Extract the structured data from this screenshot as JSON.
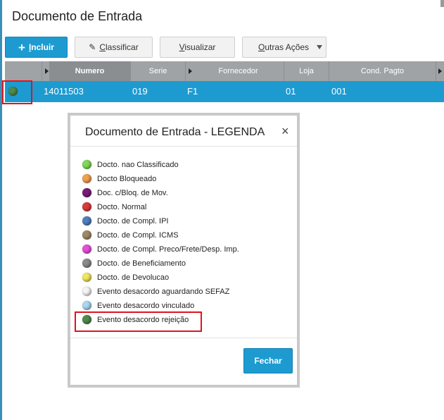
{
  "page": {
    "title": "Documento de Entrada"
  },
  "toolbar": {
    "incluir_plus": "+",
    "incluir_underlined": "I",
    "incluir_rest": "ncluir",
    "classificar_underlined": "C",
    "classificar_rest": "lassificar",
    "visualizar_underlined": "V",
    "visualizar_rest": "isualizar",
    "outras_underlined": "O",
    "outras_rest": "utras Ações"
  },
  "grid": {
    "columns": {
      "numero": "Numero",
      "serie": "Serie",
      "fornecedor": "Fornecedor",
      "loja": "Loja",
      "cond_pagto": "Cond. Pagto"
    },
    "row": {
      "status_color": "#4f8a4a",
      "numero": "14011503",
      "serie": "019",
      "fornecedor": "F1",
      "loja": "01",
      "cond_pagto": "001"
    }
  },
  "modal": {
    "title": "Documento de Entrada - LEGENDA",
    "close_icon": "×",
    "items": [
      {
        "label": "Docto. nao Classificado",
        "color": "#7ed957"
      },
      {
        "label": "Docto Bloqueado",
        "color": "#f0a050"
      },
      {
        "label": "Doc. c/Bloq. de Mov.",
        "color": "#7a1a7a"
      },
      {
        "label": "Docto. Normal",
        "color": "#d93a3a"
      },
      {
        "label": "Docto. de Compl. IPI",
        "color": "#4f7fc0"
      },
      {
        "label": "Docto. de Compl. ICMS",
        "color": "#a08866"
      },
      {
        "label": "Docto. de Compl. Preco/Frete/Desp. Imp.",
        "color": "#e64fd8"
      },
      {
        "label": "Docto. de Beneficiamento",
        "color": "#8a8a8a"
      },
      {
        "label": "Docto. de Devolucao",
        "color": "#f0e65a"
      },
      {
        "label": "Evento desacordo aguardando SEFAZ",
        "color": "#f4f4f4"
      },
      {
        "label": "Evento desacordo vinculado",
        "color": "#a8d8f0"
      },
      {
        "label": "Evento desacordo rejeição",
        "color": "#4f8a4a"
      }
    ],
    "close_button": "Fechar"
  }
}
